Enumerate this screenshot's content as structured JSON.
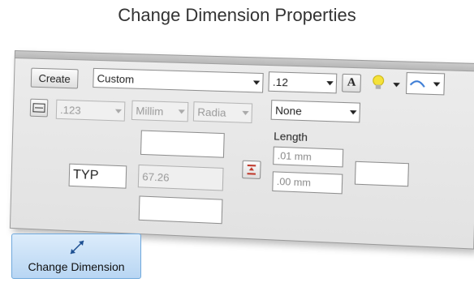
{
  "title": "Change Dimension Properties",
  "toolbar": {
    "create_label": "Create",
    "style_value": "Custom",
    "text_size_value": ".12",
    "font_icon": "A"
  },
  "row2": {
    "precision_value": ".123",
    "units_value": "Millim",
    "angle_value": "Radia",
    "tolerance_value": "None"
  },
  "fields": {
    "prefix_value": "TYP",
    "dimension_value": "67.26",
    "length_label": "Length",
    "upper_tol_value": ".01 mm",
    "lower_tol_value": ".00 mm"
  },
  "ribbon": {
    "label": "Change Dimension"
  },
  "colors": {
    "bulb": "#f5e23a",
    "ribbon_bg": "#c7e0f7",
    "tool_red": "#c0392b"
  }
}
